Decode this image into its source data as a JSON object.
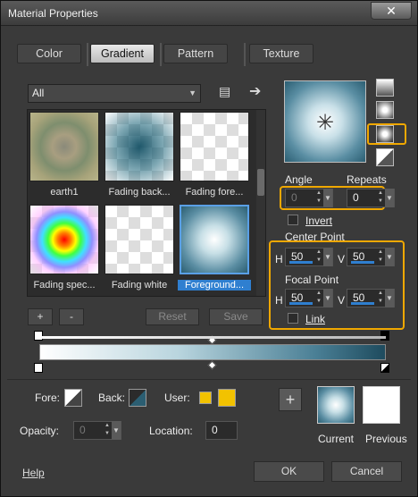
{
  "window": {
    "title": "Material Properties",
    "close_glyph": "✕"
  },
  "tabs": [
    {
      "label": "Color",
      "active": false
    },
    {
      "label": "Gradient",
      "active": true
    },
    {
      "label": "Pattern",
      "active": false
    },
    {
      "label": "Texture",
      "active": false
    }
  ],
  "library": {
    "category": "All",
    "swatches": [
      {
        "label": "earth1",
        "selected": false
      },
      {
        "label": "Fading back...",
        "selected": false
      },
      {
        "label": "Fading fore...",
        "selected": false
      },
      {
        "label": "Fading spec...",
        "selected": false
      },
      {
        "label": "Fading white",
        "selected": false
      },
      {
        "label": "Foreground...",
        "selected": true
      }
    ],
    "add_label": "+",
    "remove_label": "-",
    "reset_label": "Reset",
    "save_label": "Save"
  },
  "gradient_settings": {
    "angle_label": "Angle",
    "angle_value": "0",
    "repeats_label": "Repeats",
    "repeats_value": "0",
    "invert_label": "Invert",
    "center_point_label": "Center Point",
    "center_h_label": "H",
    "center_h": "50",
    "center_v_label": "V",
    "center_v": "50",
    "focal_point_label": "Focal Point",
    "focal_h_label": "H",
    "focal_h": "50",
    "focal_v_label": "V",
    "focal_v": "50",
    "link_label": "Link",
    "selected_mode": "radial"
  },
  "stops_editor": {
    "fore_label": "Fore:",
    "back_label": "Back:",
    "user_label": "User:",
    "opacity_label": "Opacity:",
    "opacity_value": "0",
    "location_label": "Location:",
    "location_value": "0"
  },
  "compare": {
    "current_label": "Current",
    "previous_label": "Previous",
    "add_label": "+"
  },
  "footer": {
    "help_label": "Help",
    "ok_label": "OK",
    "cancel_label": "Cancel"
  },
  "colors": {
    "highlight": "#f0a800",
    "accent": "#2f7fd0",
    "user_color": "#f2c200",
    "back_color": "#2b5e72"
  }
}
